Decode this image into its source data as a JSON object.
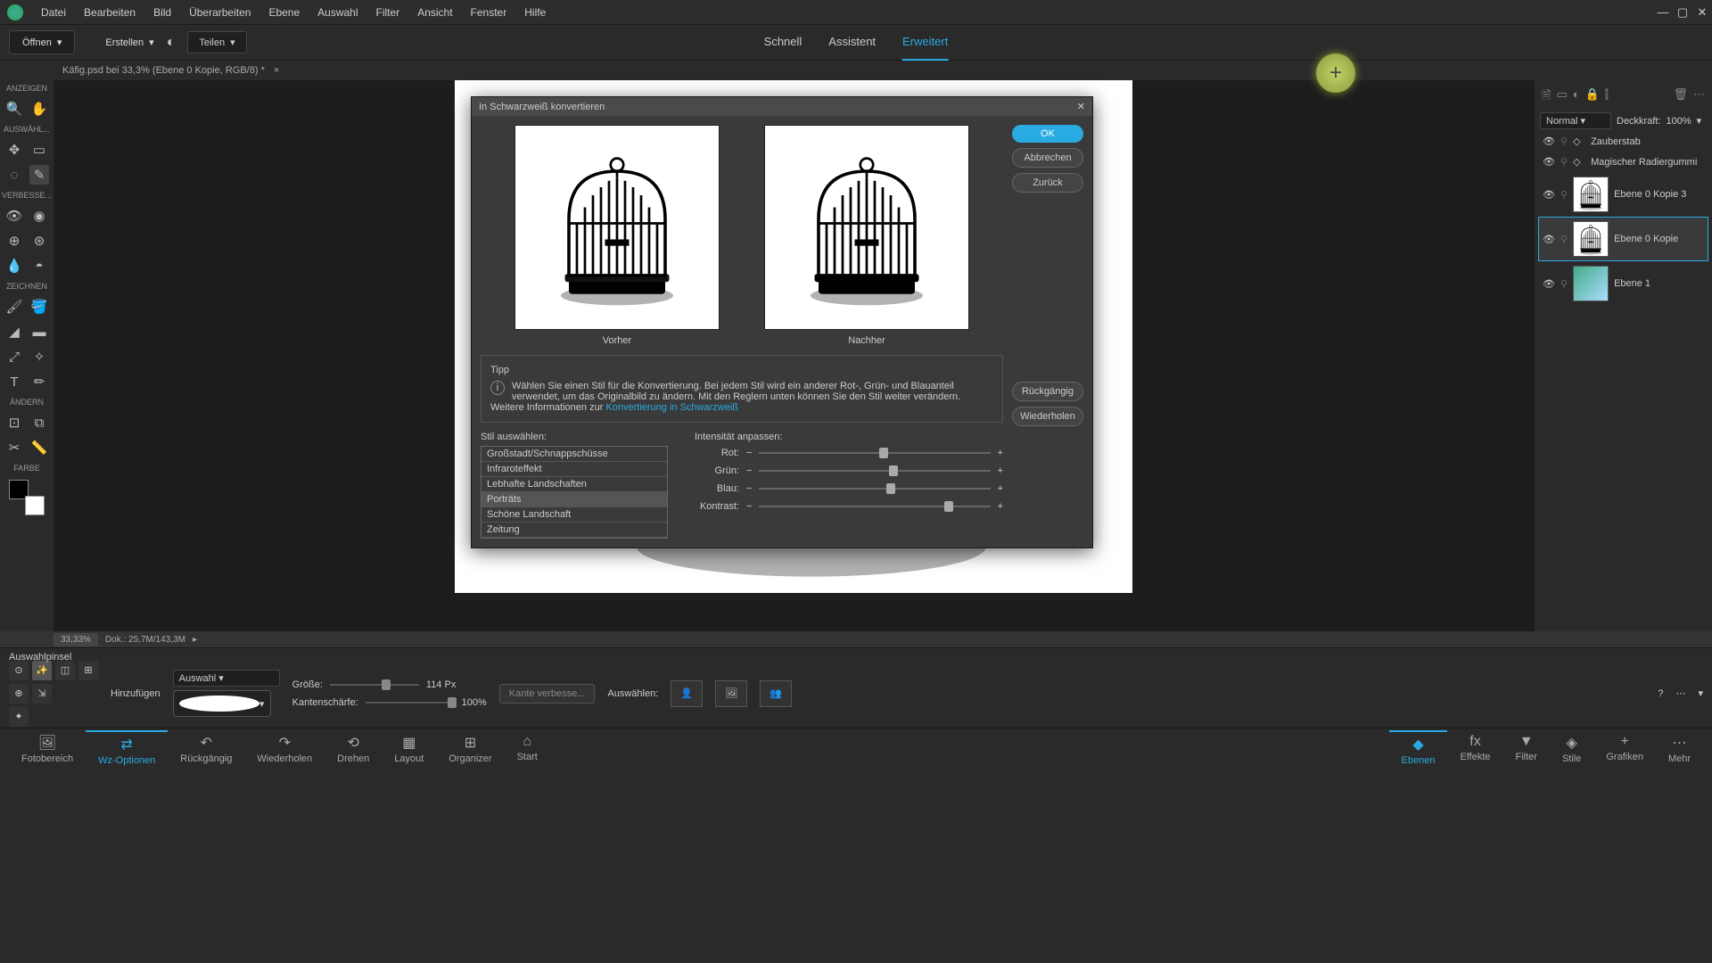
{
  "menu": {
    "items": [
      "Datei",
      "Bearbeiten",
      "Bild",
      "Überarbeiten",
      "Ebene",
      "Auswahl",
      "Filter",
      "Ansicht",
      "Fenster",
      "Hilfe"
    ]
  },
  "toolbar": {
    "open": "Öffnen",
    "create": "Erstellen",
    "share": "Teilen"
  },
  "tabs": {
    "quick": "Schnell",
    "guided": "Assistent",
    "expert": "Erweitert"
  },
  "doc": {
    "title": "Käfig.psd bei 33,3% (Ebene 0 Kopie, RGB/8) *"
  },
  "toolgroups": {
    "view": "ANZEIGEN",
    "select": "AUSWÄHL...",
    "enhance": "VERBESSE...",
    "draw": "ZEICHNEN",
    "modify": "ÄNDERN",
    "color": "FARBE"
  },
  "status": {
    "zoom": "33,33%",
    "doc": "Dok.: 25,7M/143,3M"
  },
  "options": {
    "title": "Auswahlpinsel",
    "add": "Hinzufügen",
    "mode": "Auswahl",
    "size": "Größe:",
    "sizev": "114 Px",
    "hard": "Kantenschärfe:",
    "hardv": "100%",
    "refine": "Kante verbesse...",
    "selectlbl": "Auswählen:"
  },
  "footer": {
    "left": [
      {
        "k": "photobin",
        "l": "Fotobereich"
      },
      {
        "k": "toolopt",
        "l": "Wz-Optionen"
      },
      {
        "k": "undo",
        "l": "Rückgängig"
      },
      {
        "k": "redo",
        "l": "Wiederholen"
      },
      {
        "k": "rotate",
        "l": "Drehen"
      },
      {
        "k": "layout",
        "l": "Layout"
      },
      {
        "k": "org",
        "l": "Organizer"
      },
      {
        "k": "home",
        "l": "Start"
      }
    ],
    "right": [
      {
        "k": "layers",
        "l": "Ebenen"
      },
      {
        "k": "fx",
        "l": "Effekte"
      },
      {
        "k": "filter",
        "l": "Filter"
      },
      {
        "k": "styles",
        "l": "Stile"
      },
      {
        "k": "graphics",
        "l": "Grafiken"
      },
      {
        "k": "more",
        "l": "Mehr"
      }
    ]
  },
  "layers": {
    "blend": "Normal",
    "opacityLbl": "Deckkraft:",
    "opacityVal": "100%",
    "items": [
      {
        "n": "Zauberstab",
        "thumb": "none"
      },
      {
        "n": "Magischer Radiergummi",
        "thumb": "none"
      },
      {
        "n": "Ebene 0 Kopie 3",
        "thumb": "cage"
      },
      {
        "n": "Ebene 0 Kopie",
        "thumb": "cage",
        "sel": true
      },
      {
        "n": "Ebene 1",
        "thumb": "grad"
      }
    ]
  },
  "dialog": {
    "title": "In Schwarzweiß konvertieren",
    "ok": "OK",
    "cancel": "Abbrechen",
    "back": "Zurück",
    "undo": "Rückgängig",
    "redo": "Wiederholen",
    "before": "Vorher",
    "after": "Nachher",
    "tipHdr": "Tipp",
    "tipText": "Wählen Sie einen Stil für die Konvertierung. Bei jedem Stil wird ein anderer Rot-, Grün- und Blauanteil verwendet, um das Originalbild zu ändern. Mit den Reglern unten können Sie den Stil weiter verändern. Weitere Informationen zur ",
    "tipLink": "Konvertierung in Schwarzweiß",
    "styleHdr": "Stil auswählen:",
    "styles": [
      "Großstadt/Schnappschüsse",
      "Infraroteffekt",
      "Lebhafte Landschaften",
      "Porträts",
      "Schöne Landschaft",
      "Zeitung"
    ],
    "styleSel": 3,
    "intHdr": "Intensität anpassen:",
    "sliders": [
      {
        "l": "Rot:",
        "pos": 52
      },
      {
        "l": "Grün:",
        "pos": 56
      },
      {
        "l": "Blau:",
        "pos": 55
      },
      {
        "l": "Kontrast:",
        "pos": 80
      }
    ]
  }
}
